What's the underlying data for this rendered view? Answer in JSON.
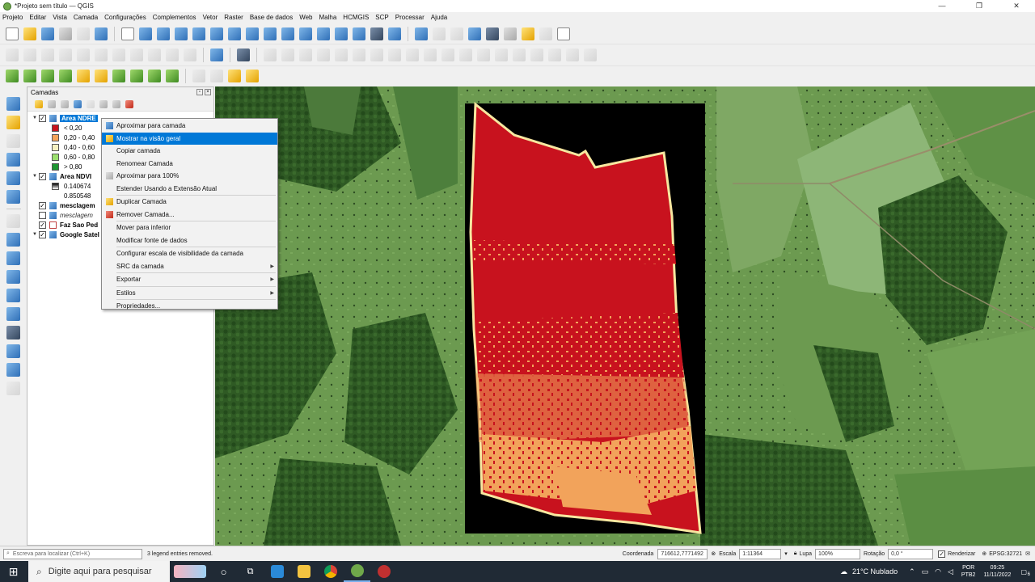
{
  "window": {
    "title": "*Projeto sem título — QGIS",
    "controls": [
      "—",
      "❐",
      "✕"
    ]
  },
  "menu": [
    "Projeto",
    "Editar",
    "Vista",
    "Camada",
    "Configurações",
    "Complementos",
    "Vetor",
    "Raster",
    "Base de dados",
    "Web",
    "Malha",
    "HCMGIS",
    "SCP",
    "Processar",
    "Ajuda"
  ],
  "layers_panel": {
    "title": "Camadas",
    "rows": [
      {
        "name": "Area NDRE",
        "checked": true,
        "selected": true,
        "style": "bold",
        "level": 0,
        "icon": "raster-icon"
      },
      {
        "name": "< 0,20",
        "swatch": "#c8141e",
        "level": 2
      },
      {
        "name": "0,20 - 0,40",
        "swatch": "#f5a55a",
        "level": 2
      },
      {
        "name": "0,40 - 0,60",
        "swatch": "#f5f0c0",
        "level": 2
      },
      {
        "name": "0,60 - 0,80",
        "swatch": "#9be06e",
        "level": 2
      },
      {
        "name": "> 0,80",
        "swatch": "#1e9632",
        "level": 2
      },
      {
        "name": "Area NDVI",
        "checked": true,
        "style": "bold",
        "level": 0,
        "icon": "raster-icon"
      },
      {
        "name": "0.140674",
        "swatch": "#000000",
        "level": 2
      },
      {
        "name": "0.850548",
        "level": 2
      },
      {
        "name": "mesclagem",
        "checked": true,
        "style": "bold",
        "level": 0,
        "icon": "raster-icon"
      },
      {
        "name": "mesclagem",
        "checked": false,
        "style": "italic",
        "level": 0,
        "icon": "raster-icon"
      },
      {
        "name": "Faz Sao Ped",
        "checked": true,
        "style": "bold",
        "level": 0,
        "icon": "polygon-icon"
      },
      {
        "name": "Google Satel",
        "checked": true,
        "style": "bold",
        "level": 0,
        "icon": "raster-icon"
      }
    ]
  },
  "context_menu": {
    "items": [
      {
        "label": "Aproximar para camada",
        "icon": "zoom-layer-icon"
      },
      {
        "label": "Mostrar na visão geral",
        "icon": "overview-icon",
        "highlight": true
      },
      {
        "label": "Copiar camada"
      },
      {
        "label": "Renomear Camada"
      },
      {
        "label": "Aproximar para 100%",
        "icon": "zoom-100-icon"
      },
      {
        "label": "Estender Usando a Extensão Atual"
      },
      {
        "sep": true
      },
      {
        "label": "Duplicar Camada",
        "icon": "duplicate-icon"
      },
      {
        "label": "Remover Camada...",
        "icon": "remove-icon"
      },
      {
        "sep": true
      },
      {
        "label": "Mover para inferior"
      },
      {
        "label": "Modificar fonte de dados"
      },
      {
        "sep": true
      },
      {
        "label": "Configurar escala de visibilidade da camada"
      },
      {
        "label": "SRC da camada",
        "submenu": true
      },
      {
        "label": "Exportar",
        "submenu": true
      },
      {
        "label": "Estilos",
        "submenu": true
      },
      {
        "label": "Propriedades..."
      }
    ]
  },
  "statusbar": {
    "locator_placeholder": "Escreva para localizar (Ctrl+K)",
    "message": "3 legend entries removed.",
    "coord_label": "Coordenada",
    "coord_value": "716612,7771492",
    "scale_label": "Escala",
    "scale_value": "1:11364",
    "magnifier_label": "Lupa",
    "magnifier_value": "100%",
    "rotation_label": "Rotação",
    "rotation_value": "0,0 °",
    "render_label": "Renderizar",
    "crs": "EPSG:32721"
  },
  "taskbar": {
    "search_placeholder": "Digite aqui para pesquisar",
    "weather": "21°C  Nublado",
    "lang": "POR",
    "kbd": "PTB2",
    "time": "09:25",
    "date": "11/11/2022",
    "notif": "6"
  },
  "ndre_colors": {
    "red": "#c8121e",
    "orange": "#f2a35b",
    "pale": "#f7e7a0"
  }
}
